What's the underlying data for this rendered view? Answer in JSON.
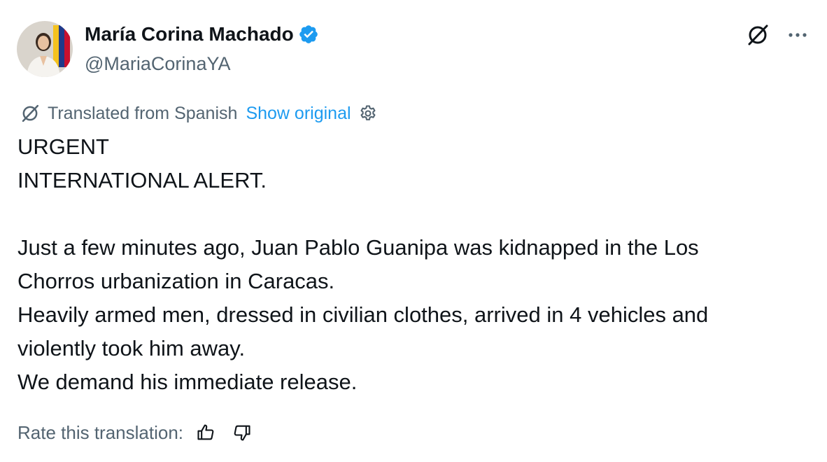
{
  "author": {
    "name": "María Corina Machado",
    "handle": "@MariaCorinaYA",
    "verified": true
  },
  "icons": {
    "avatar": "profile-photo",
    "verified": "verified-badge-icon",
    "grok": "grok-icon",
    "more": "more-options-icon",
    "translate": "grok-icon",
    "settings": "gear-icon",
    "thumbs_up": "thumbs-up-icon",
    "thumbs_down": "thumbs-down-icon"
  },
  "translation": {
    "label": "Translated from Spanish",
    "show_original": "Show original"
  },
  "tweet": {
    "lines": [
      "URGENT",
      "INTERNATIONAL ALERT.",
      "",
      "Just a few minutes ago, Juan Pablo Guanipa was kidnapped in the Los",
      "Chorros urbanization in Caracas.",
      "Heavily armed men, dressed in civilian clothes, arrived in 4 vehicles and",
      "violently took him away.",
      "We demand his immediate release."
    ]
  },
  "rating": {
    "label": "Rate this translation:"
  },
  "colors": {
    "text_primary": "#0f1419",
    "text_secondary": "#536471",
    "link": "#1d9bf0",
    "verified": "#1d9bf0"
  }
}
